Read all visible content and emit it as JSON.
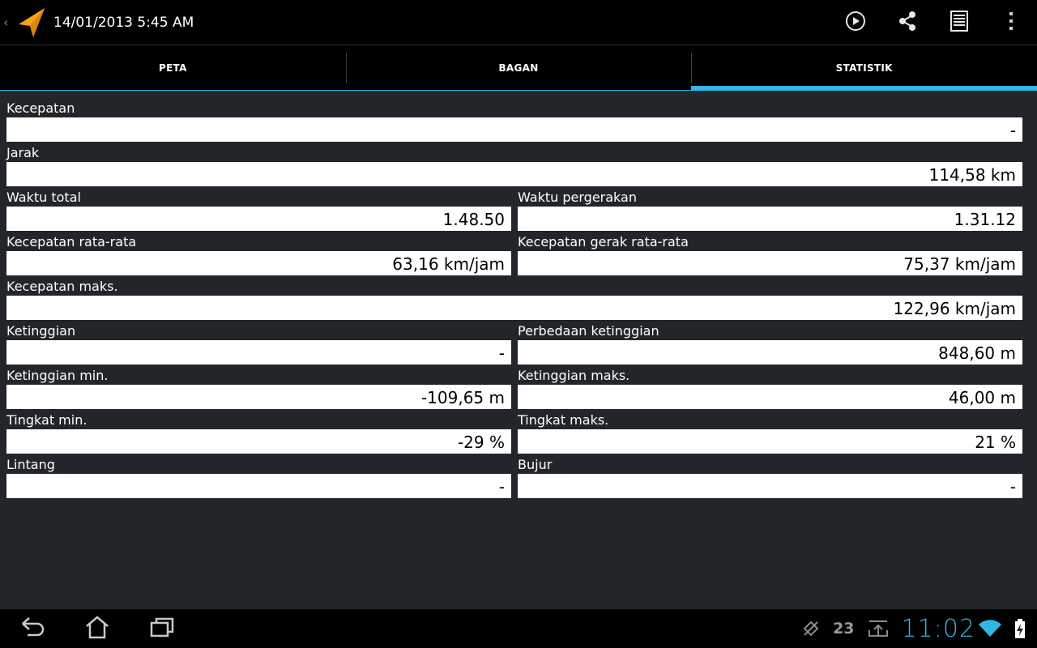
{
  "action_bar": {
    "title": "14/01/2013 5:45 AM",
    "up_caret": "‹",
    "actions": [
      {
        "name": "play-icon"
      },
      {
        "name": "share-icon"
      },
      {
        "name": "list-icon"
      },
      {
        "name": "overflow-menu-icon"
      }
    ],
    "app_icon_color": "#f7a21c"
  },
  "tabs": [
    {
      "label": "PETA",
      "selected": false
    },
    {
      "label": "BAGAN",
      "selected": false
    },
    {
      "label": "STATISTIK",
      "selected": true
    }
  ],
  "accent_color": "#33b5e5",
  "stats": {
    "kecepatan": {
      "label": "Kecepatan",
      "value": "-"
    },
    "jarak": {
      "label": "Jarak",
      "value": "114,58 km"
    },
    "waktu_total": {
      "label": "Waktu total",
      "value": "1.48.50"
    },
    "waktu_pergerakan": {
      "label": "Waktu pergerakan",
      "value": "1.31.12"
    },
    "kecepatan_rata": {
      "label": "Kecepatan rata-rata",
      "value": "63,16 km/jam"
    },
    "kecepatan_gerak_rata": {
      "label": "Kecepatan gerak rata-rata",
      "value": "75,37 km/jam"
    },
    "kecepatan_maks": {
      "label": "Kecepatan maks.",
      "value": "122,96 km/jam"
    },
    "ketinggian": {
      "label": "Ketinggian",
      "value": "-"
    },
    "perbedaan_ketinggian": {
      "label": "Perbedaan ketinggian",
      "value": "848,60 m"
    },
    "ketinggian_min": {
      "label": "Ketinggian min.",
      "value": "-109,65 m"
    },
    "ketinggian_maks": {
      "label": "Ketinggian maks.",
      "value": "46,00 m"
    },
    "tingkat_min": {
      "label": "Tingkat min.",
      "value": "-29 %"
    },
    "tingkat_maks": {
      "label": "Tingkat maks.",
      "value": "21 %"
    },
    "lintang": {
      "label": "Lintang",
      "value": "-"
    },
    "bujur": {
      "label": "Bujur",
      "value": "-"
    }
  },
  "system_bar": {
    "nav": [
      {
        "name": "back-icon"
      },
      {
        "name": "home-icon"
      },
      {
        "name": "recent-apps-icon"
      }
    ],
    "notification_count": "23",
    "clock": "11:02",
    "status_icons": [
      "gps-off-icon",
      "upload-icon",
      "wifi-icon",
      "battery-charging-icon"
    ]
  }
}
